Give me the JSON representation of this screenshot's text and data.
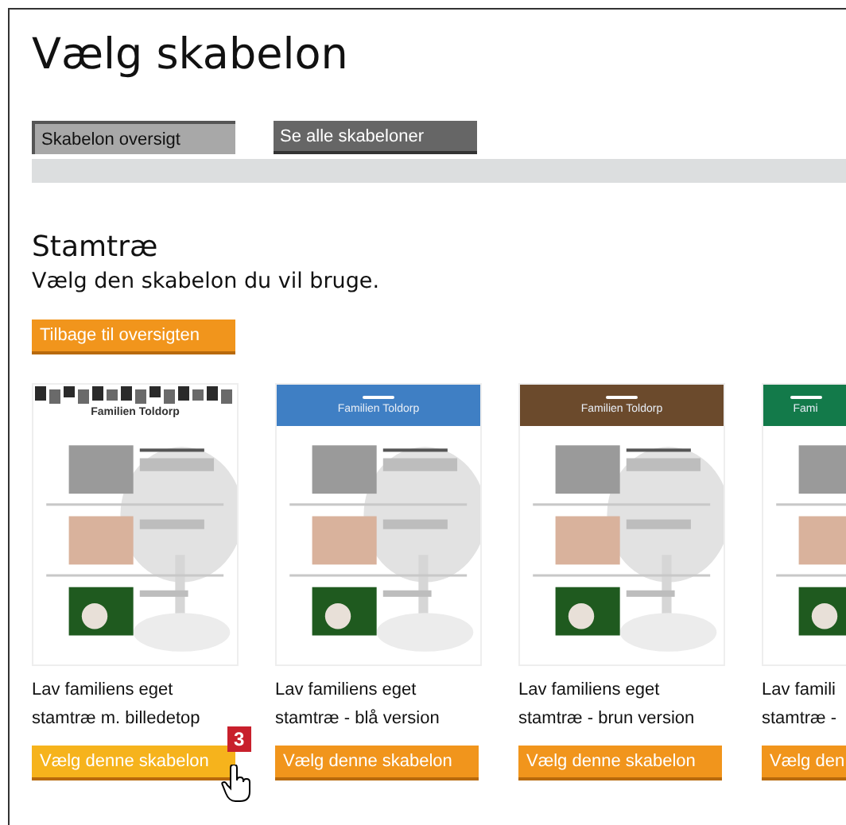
{
  "title": "Vælg skabelon",
  "tabs": [
    {
      "label": "Skabelon oversigt",
      "selected": true
    },
    {
      "label": "Se alle skabeloner",
      "selected": false
    }
  ],
  "section": {
    "heading": "Stamtræ",
    "subtitle": "Vælg den skabelon du vil bruge."
  },
  "back_button": "Tilbage til oversigten",
  "templates": [
    {
      "kind": "photo-strip",
      "header_title": "Familien Toldorp",
      "line_1": "Lav familiens eget",
      "line_2": "stamtræ m. billedetop",
      "button": "Vælg denne skabelon",
      "hovered": true,
      "badge": "3"
    },
    {
      "kind": "band",
      "color": "#3f7fc4",
      "header_title": "Familien Toldorp",
      "line_1": "Lav familiens eget",
      "line_2": "stamtræ - blå version",
      "button": "Vælg denne skabelon",
      "hovered": false
    },
    {
      "kind": "band",
      "color": "#6b4a2c",
      "header_title": "Familien Toldorp",
      "line_1": "Lav familiens eget",
      "line_2": "stamtræ - brun version",
      "button": "Vælg denne skabelon",
      "hovered": false
    },
    {
      "kind": "band",
      "color": "#137a4a",
      "header_title": "Fami",
      "line_1": "Lav famili",
      "line_2": "stamtræ -",
      "button": "Vælg den",
      "hovered": false
    }
  ]
}
